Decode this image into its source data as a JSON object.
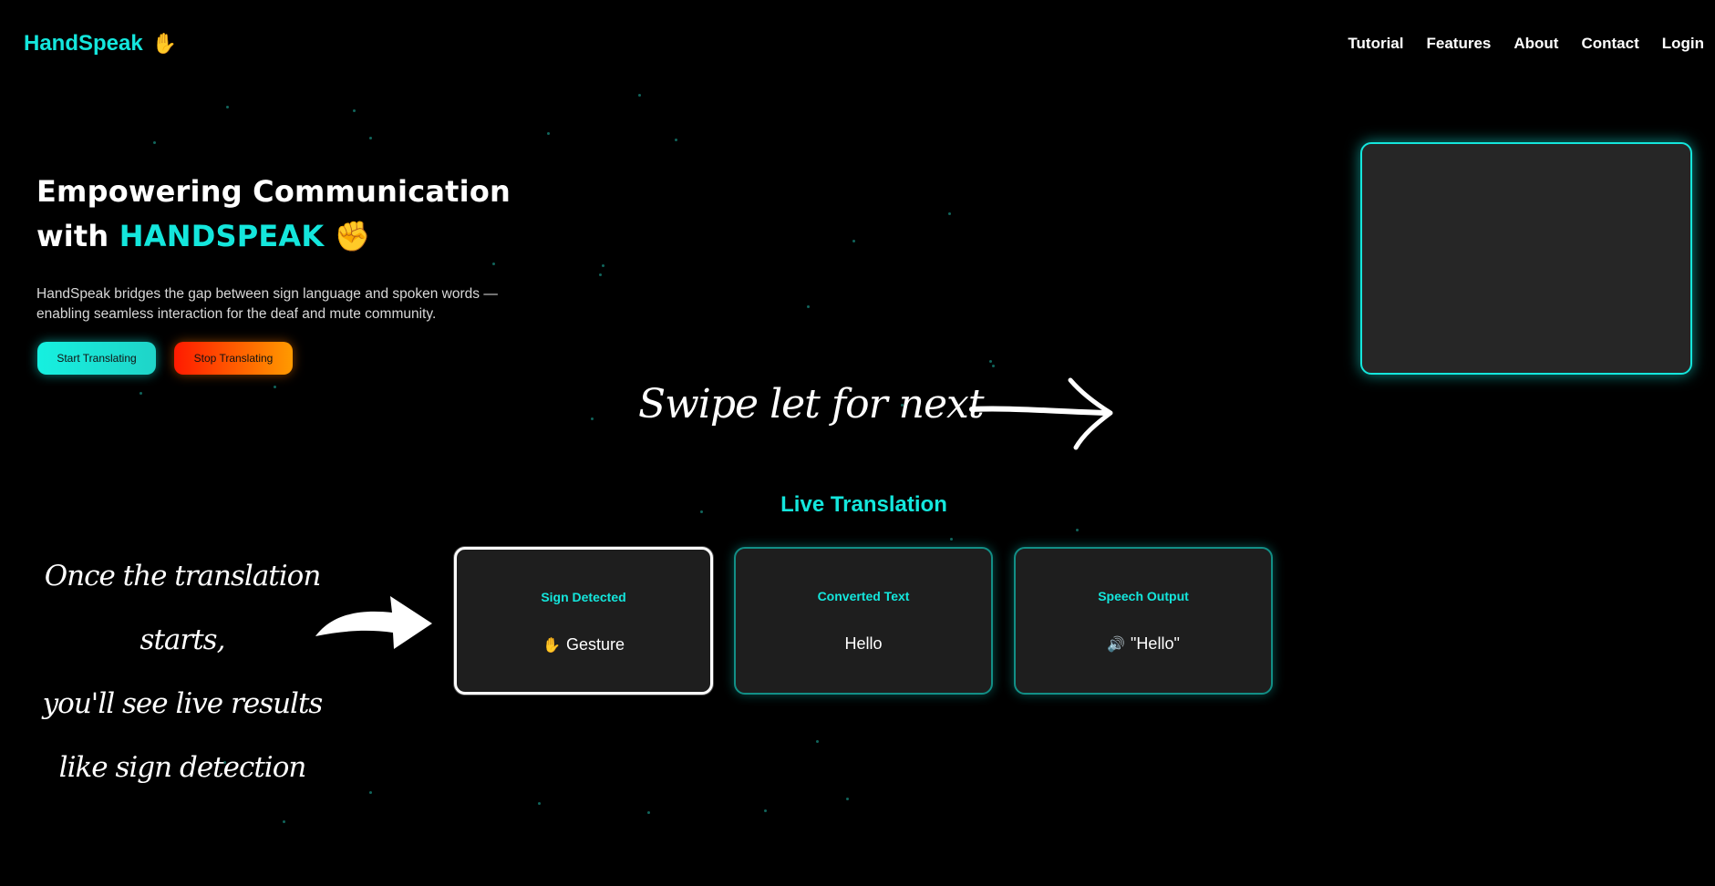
{
  "brand": {
    "name": "HandSpeak",
    "hand_icon": "✋"
  },
  "nav": {
    "items": [
      "Tutorial",
      "Features",
      "About",
      "Contact",
      "Login"
    ]
  },
  "hero": {
    "title_line1": "Empowering Communication",
    "title_line2_prefix": "with",
    "title_accent": "HANDSPEAK",
    "title_emoji": "✊",
    "description_line1": "HandSpeak bridges the gap between sign language and spoken words —",
    "description_line2": "enabling seamless interaction for the deaf and mute community.",
    "start_label": "Start Translating",
    "stop_label": "Stop Translating"
  },
  "annotations": {
    "swipe": "Swipe let for next",
    "once_line1": "Once the translation starts,",
    "once_line2": "you'll see live results",
    "once_line3": "like sign detection"
  },
  "live": {
    "title": "Live Translation",
    "cards": [
      {
        "label": "Sign Detected",
        "icon": "✋",
        "value": "Gesture"
      },
      {
        "label": "Converted Text",
        "icon": "",
        "value": "Hello"
      },
      {
        "label": "Speech Output",
        "icon": "🔊",
        "value": "\"Hello\""
      }
    ]
  },
  "colors": {
    "accent": "#14e6dc",
    "background": "#000000",
    "card": "#1e1e1e",
    "stop_start": "#ff1a00",
    "stop_end": "#ff9a00"
  }
}
